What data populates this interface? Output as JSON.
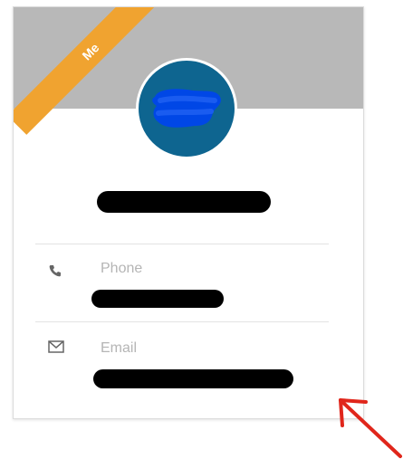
{
  "badge": {
    "label": "Me"
  },
  "contact": {
    "phone": {
      "label": "Phone",
      "icon": "phone-icon"
    },
    "email": {
      "label": "Email",
      "icon": "envelope-icon"
    }
  },
  "colors": {
    "banner": "#b8b8b8",
    "ribbon": "#f0a330",
    "avatar": "#0e6590",
    "avatar_scribble": "#0047e6",
    "annotation_arrow": "#e0261b"
  }
}
